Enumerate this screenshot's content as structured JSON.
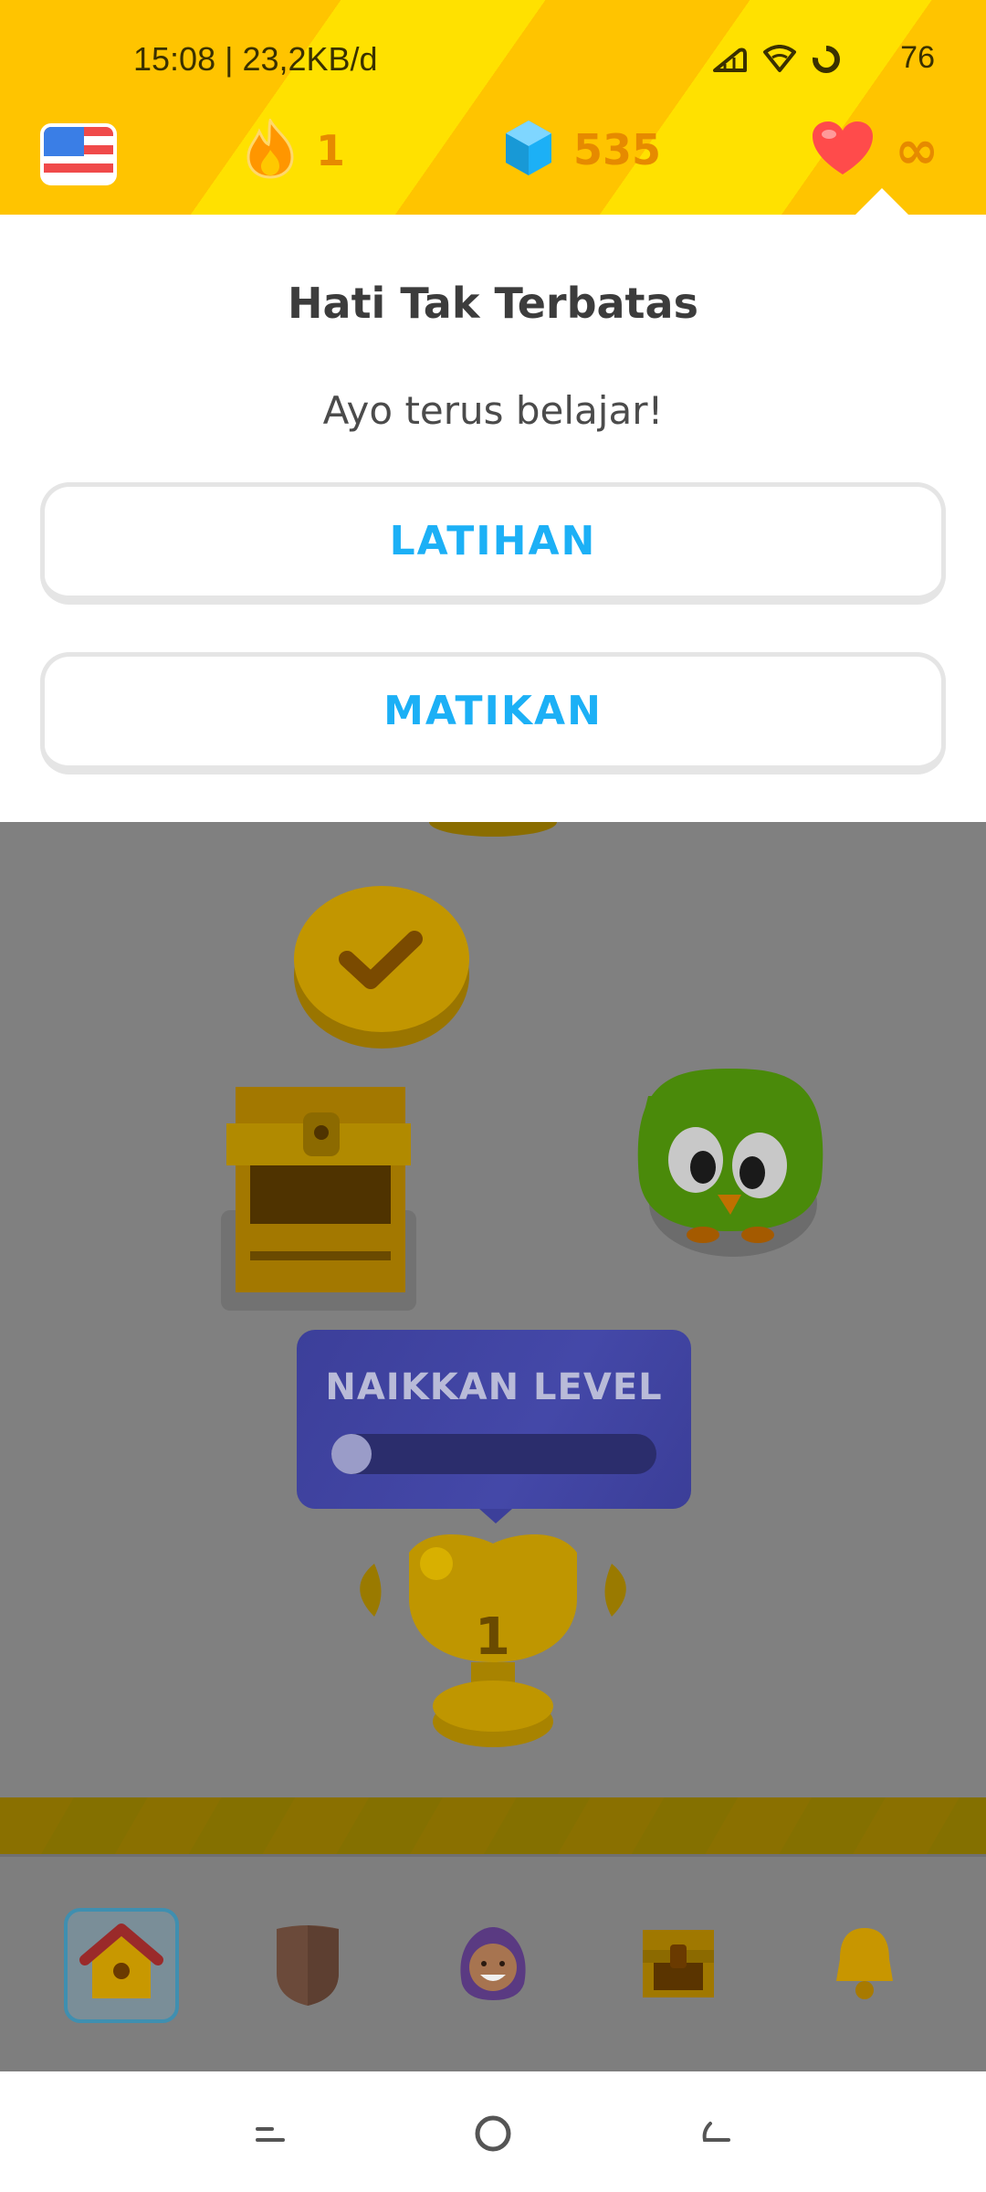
{
  "status_bar": {
    "time": "15:08 | 23,2KB/d",
    "battery": "76"
  },
  "stats": {
    "streak": "1",
    "gems": "535",
    "hearts": "∞"
  },
  "popover": {
    "title": "Hati Tak Terbatas",
    "subtitle": "Ayo terus belajar!",
    "practice_label": "LATIHAN",
    "turn_off_label": "MATIKAN"
  },
  "path": {
    "level_up_label": "NAIKKAN LEVEL",
    "level_up_progress": 0.08,
    "trophy_number": "1"
  },
  "tabs": [
    {
      "name": "learn",
      "active": true
    },
    {
      "name": "leagues",
      "active": false
    },
    {
      "name": "profile",
      "active": false
    },
    {
      "name": "shop",
      "active": false
    },
    {
      "name": "notifications",
      "active": false
    }
  ],
  "colors": {
    "accent_blue": "#1cb0f6",
    "header_yellow": "#ffc400",
    "gem_blue": "#1cb0f6",
    "heart_red": "#ff4b4b"
  }
}
